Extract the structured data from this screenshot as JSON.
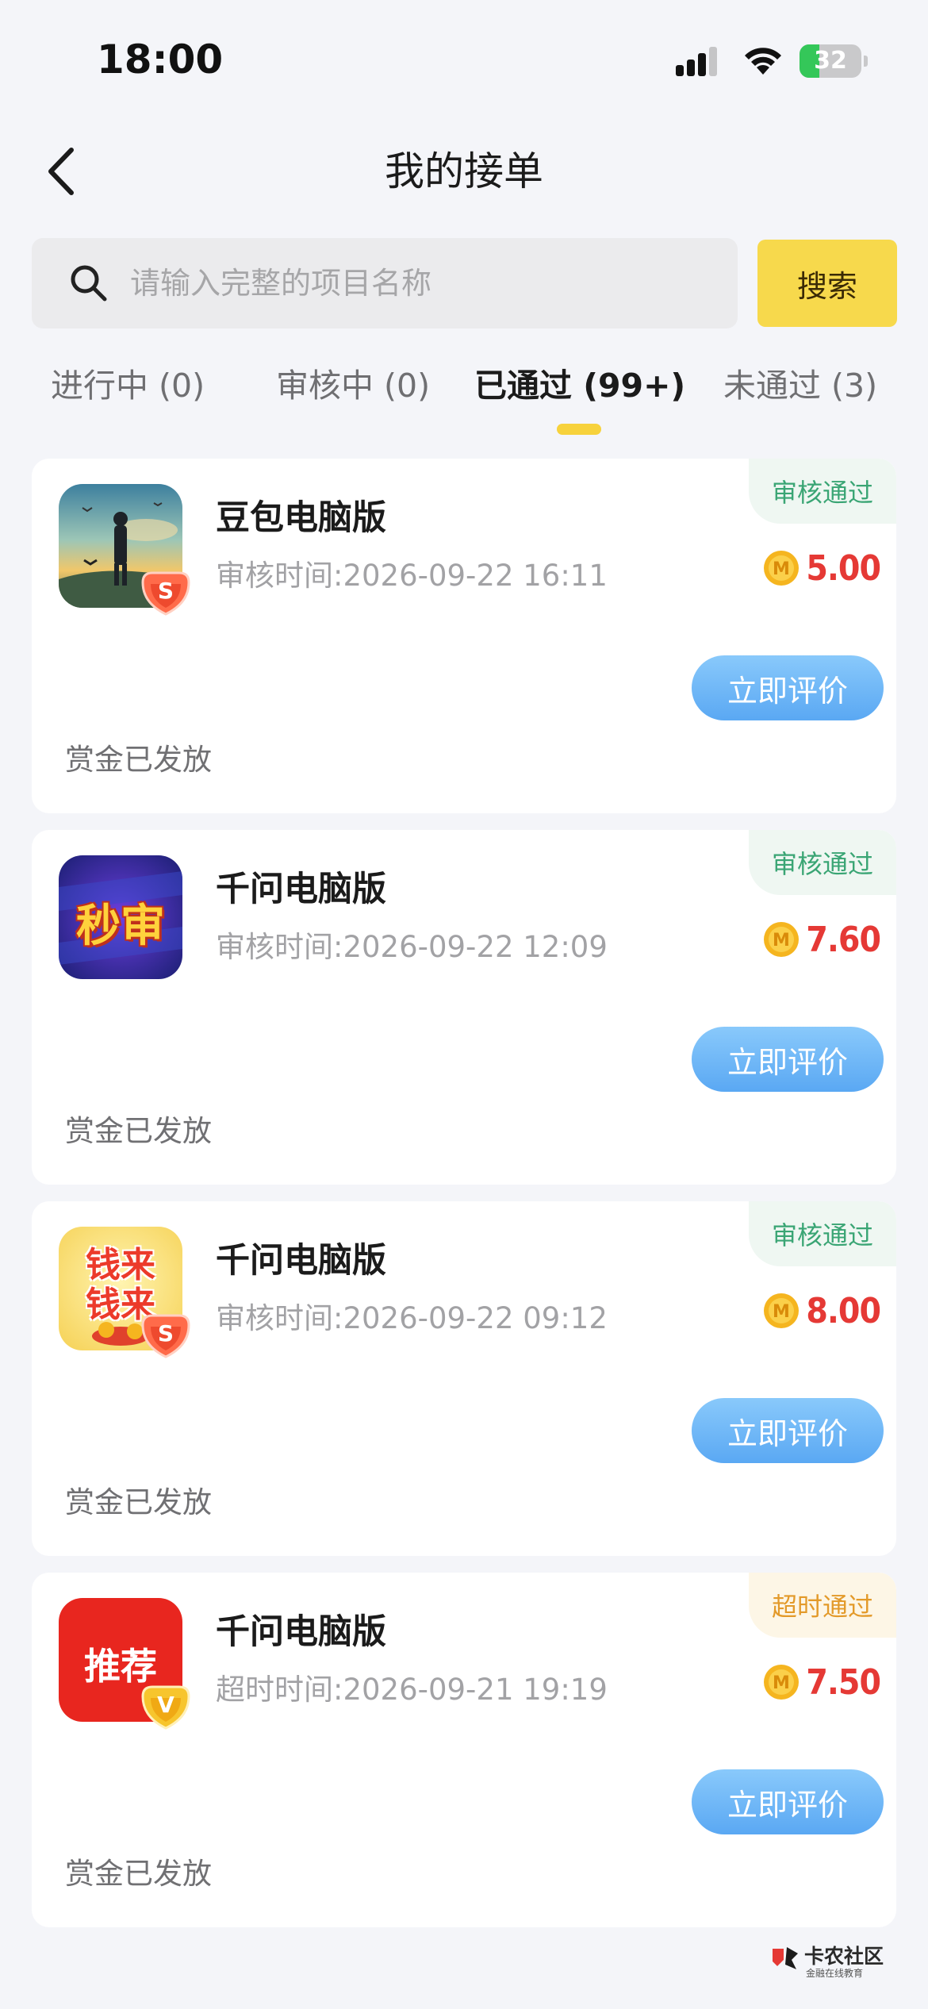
{
  "status_bar": {
    "time": "18:00",
    "battery": "32",
    "battery_level": 0.32
  },
  "header": {
    "title": "我的接单",
    "back_icon": "chevron-left-icon"
  },
  "search": {
    "placeholder": "请输入完整的项目名称",
    "value": "",
    "button_label": "搜索"
  },
  "tabs": [
    {
      "label": "进行中 (0)",
      "active": false
    },
    {
      "label": "审核中 (0)",
      "active": false
    },
    {
      "label": "已通过 (99+)",
      "active": true
    },
    {
      "label": "未通过 (3)",
      "active": false
    }
  ],
  "orders": [
    {
      "app_name": "豆包电脑版",
      "time_text": "审核时间:2026-09-22 16:11",
      "status": "审核通过",
      "status_type": "pass",
      "reward": "5.00",
      "action_label": "立即评价",
      "payout": "赏金已发放",
      "icon": "landscape-art-icon",
      "badge_letter": "S"
    },
    {
      "app_name": "千问电脑版",
      "time_text": "审核时间:2026-09-22 12:09",
      "status": "审核通过",
      "status_type": "pass",
      "reward": "7.60",
      "action_label": "立即评价",
      "payout": "赏金已发放",
      "icon": "miaoshen-icon",
      "icon_text": "秒审"
    },
    {
      "app_name": "千问电脑版",
      "time_text": "审核时间:2026-09-22 09:12",
      "status": "审核通过",
      "status_type": "pass",
      "reward": "8.00",
      "action_label": "立即评价",
      "payout": "赏金已发放",
      "icon": "qianlai-icon",
      "icon_text_1": "钱来",
      "icon_text_2": "钱来",
      "badge_letter": "S"
    },
    {
      "app_name": "千问电脑版",
      "time_text": "超时时间:2026-09-21 19:19",
      "status": "超时通过",
      "status_type": "timeout",
      "reward": "7.50",
      "action_label": "立即评价",
      "payout": "赏金已发放",
      "icon": "tuijian-icon",
      "icon_text": "推荐",
      "badge_letter": "V"
    }
  ],
  "watermark": {
    "title": "卡农社区",
    "subtitle": "金融在线教育"
  },
  "colors": {
    "accent_yellow": "#f7d94c",
    "reward_red": "#e53935",
    "pass_green": "#3aa574",
    "timeout_orange": "#e39a2a",
    "button_blue": "#6bb6f7"
  }
}
